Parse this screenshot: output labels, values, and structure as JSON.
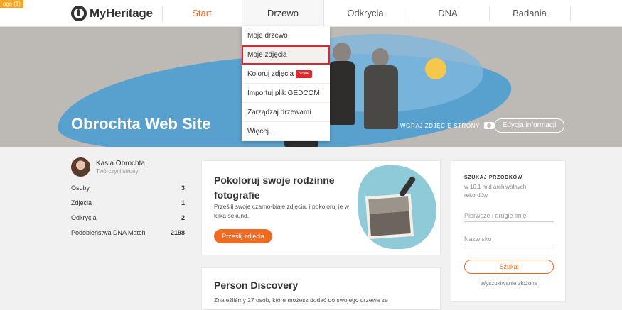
{
  "corner_badge": "ogs (1)",
  "logo": {
    "text": "MyHeritage"
  },
  "nav": {
    "start": "Start",
    "tree": "Drzewo",
    "discoveries": "Odkrycia",
    "dna": "DNA",
    "research": "Badania"
  },
  "dropdown": {
    "items": [
      {
        "label": "Moje drzewo"
      },
      {
        "label": "Moje zdjęcia"
      },
      {
        "label": "Koloruj zdjęcia",
        "badge": "Nowe"
      },
      {
        "label": "Importuj plik GEDCOM"
      },
      {
        "label": "Zarządzaj drzewami"
      },
      {
        "label": "Więcej..."
      }
    ]
  },
  "hero": {
    "site_title": "Obrochta Web Site",
    "upload_label": "WGRAJ ZDJĘCIE STRONY",
    "edit_label": "Edycja informacji"
  },
  "owner": {
    "name": "Kasia Obrochta",
    "role": "Twórczyni strony"
  },
  "stats": [
    {
      "label": "Osoby",
      "value": "3"
    },
    {
      "label": "Zdjęcia",
      "value": "1"
    },
    {
      "label": "Odkrycia",
      "value": "2"
    },
    {
      "label": "Podobieństwa DNA Match",
      "value": "2198"
    }
  ],
  "colorize_card": {
    "title": "Pokoloruj swoje rodzinne fotografie",
    "description": "Prześlij swoje czarno-białe zdjęcia, i pokoloruj je w kilka sekund.",
    "button": "Prześlij zdjęcia"
  },
  "discovery_card": {
    "title": "Person Discovery",
    "description": "Znaleźliśmy 27 osób, które możesz dodać do swojego drzewa ze"
  },
  "search_card": {
    "title": "SZUKAJ PRZODKÓW",
    "subtitle": "w 10,1 mld archiwalnych rekordów",
    "first_name_placeholder": "Pierwsze i drugie imię",
    "last_name_placeholder": "Nazwisko",
    "button": "Szukaj",
    "advanced": "Wyszukiwanie złożone"
  },
  "colors": {
    "accent": "#f06a22",
    "highlight": "#e0262e",
    "hero_blue": "#4d9fd0"
  }
}
